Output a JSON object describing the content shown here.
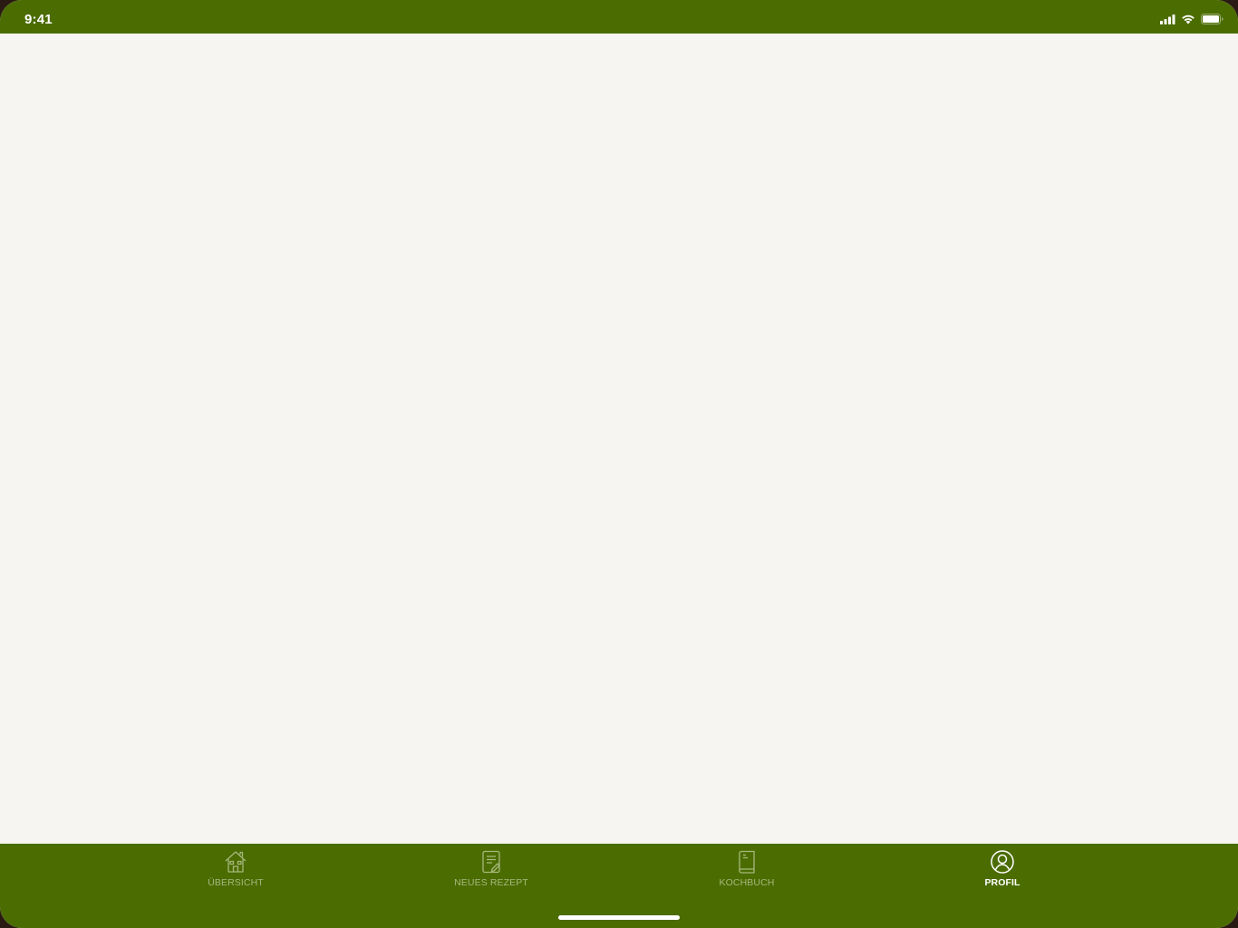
{
  "status_bar": {
    "time": "9:41",
    "icons": [
      "signal-icon",
      "wifi-icon",
      "battery-icon"
    ]
  },
  "colors": {
    "brand": "#4b6c00",
    "background": "#f6f5f1",
    "tab_inactive": "#a6b87e",
    "tab_active": "#ffffff"
  },
  "tab_bar": {
    "tabs": [
      {
        "label": "ÜBERSICHT",
        "icon": "house-icon",
        "active": false
      },
      {
        "label": "NEUES REZEPT",
        "icon": "recipe-note-icon",
        "active": false
      },
      {
        "label": "KOCHBUCH",
        "icon": "cookbook-icon",
        "active": false
      },
      {
        "label": "PROFIL",
        "icon": "profile-icon",
        "active": true
      }
    ]
  }
}
